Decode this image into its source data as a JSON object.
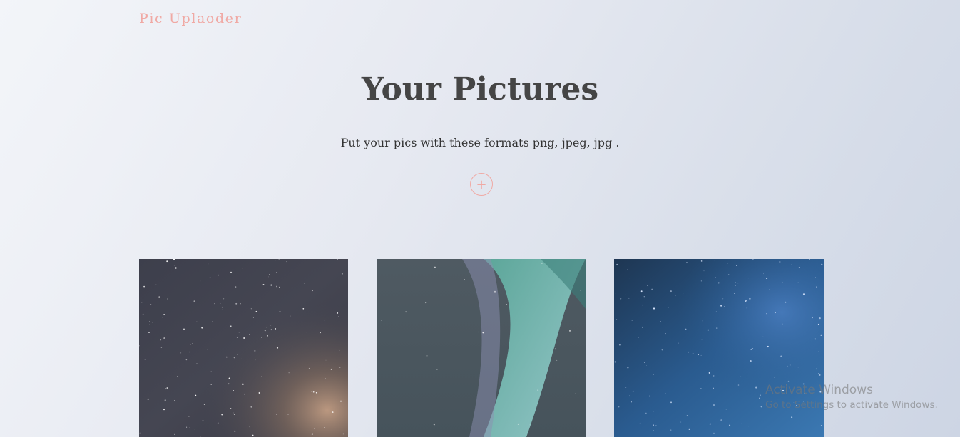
{
  "header": {
    "brand": "Pic Uplaoder"
  },
  "hero": {
    "title": "Your Pictures",
    "subtitle": "Put your pics with these formats png, jpeg, jpg .",
    "add_label": "+"
  },
  "gallery": [
    {
      "kind": "milky-way-photo"
    },
    {
      "kind": "aurora-photo"
    },
    {
      "kind": "blue-starfield-photo"
    }
  ],
  "watermark": {
    "title": "Activate Windows",
    "subtitle": "Go to Settings to activate Windows."
  },
  "colors": {
    "accent": "#f0a9a4",
    "heading": "#454545"
  }
}
